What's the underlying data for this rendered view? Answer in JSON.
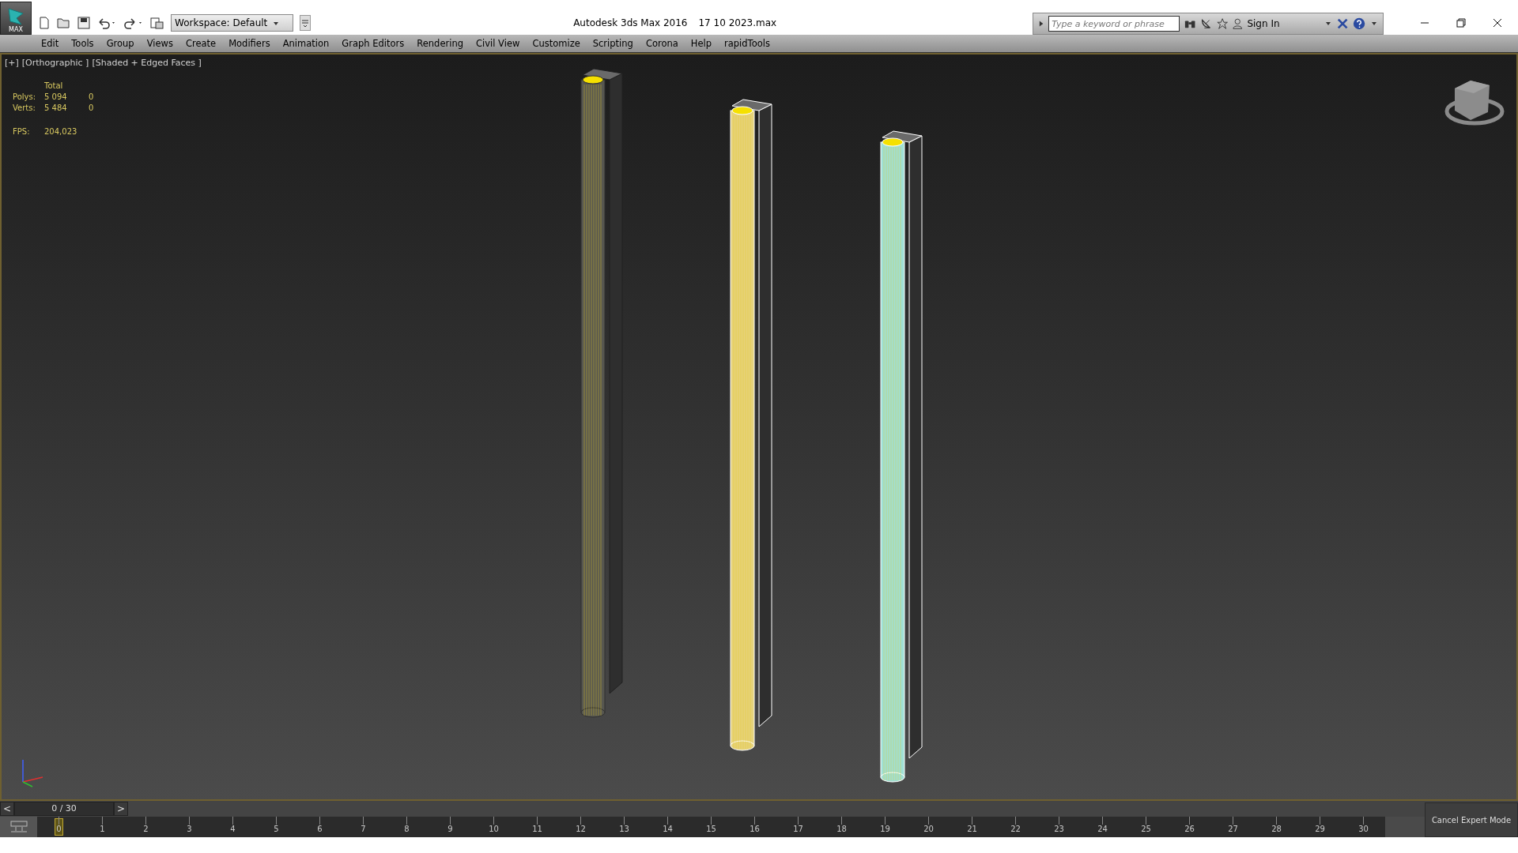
{
  "app": {
    "logo_label": "MAX"
  },
  "workspace": {
    "value": "Workspace: Default"
  },
  "title": {
    "app_name": "Autodesk 3ds Max 2016",
    "file_name": "17 10 2023.max"
  },
  "search": {
    "placeholder": "Type a keyword or phrase"
  },
  "sign_in": "Sign In",
  "menu": [
    "Edit",
    "Tools",
    "Group",
    "Views",
    "Create",
    "Modifiers",
    "Animation",
    "Graph Editors",
    "Rendering",
    "Civil View",
    "Customize",
    "Scripting",
    "Corona",
    "Help",
    "rapidTools"
  ],
  "viewport": {
    "labels": [
      "[+]",
      "[Orthographic ]",
      "[Shaded + Edged Faces ]"
    ],
    "stats": {
      "header": "Total",
      "rows": [
        {
          "label": "Polys:",
          "total": "5 094",
          "selected": "0"
        },
        {
          "label": "Verts:",
          "total": "5 484",
          "selected": "0"
        }
      ],
      "fps_label": "FPS:",
      "fps": "204,023"
    },
    "objects": [
      {
        "color": "#575750",
        "selected": false
      },
      {
        "color": "#e6d27a",
        "selected": true
      },
      {
        "color": "#9fe0d6",
        "selected": true
      }
    ]
  },
  "timeline": {
    "prev": "<",
    "frame": "0 / 30",
    "next": ">",
    "level": 0,
    "ticks": [
      "0",
      "1",
      "2",
      "3",
      "4",
      "5",
      "6",
      "7",
      "8",
      "9",
      "10",
      "11",
      "12",
      "13",
      "14",
      "15",
      "16",
      "17",
      "18",
      "19",
      "20",
      "21",
      "22",
      "23",
      "24",
      "25",
      "26",
      "27",
      "28",
      "29",
      "30"
    ]
  },
  "expert_button": "Cancel Expert Mode"
}
